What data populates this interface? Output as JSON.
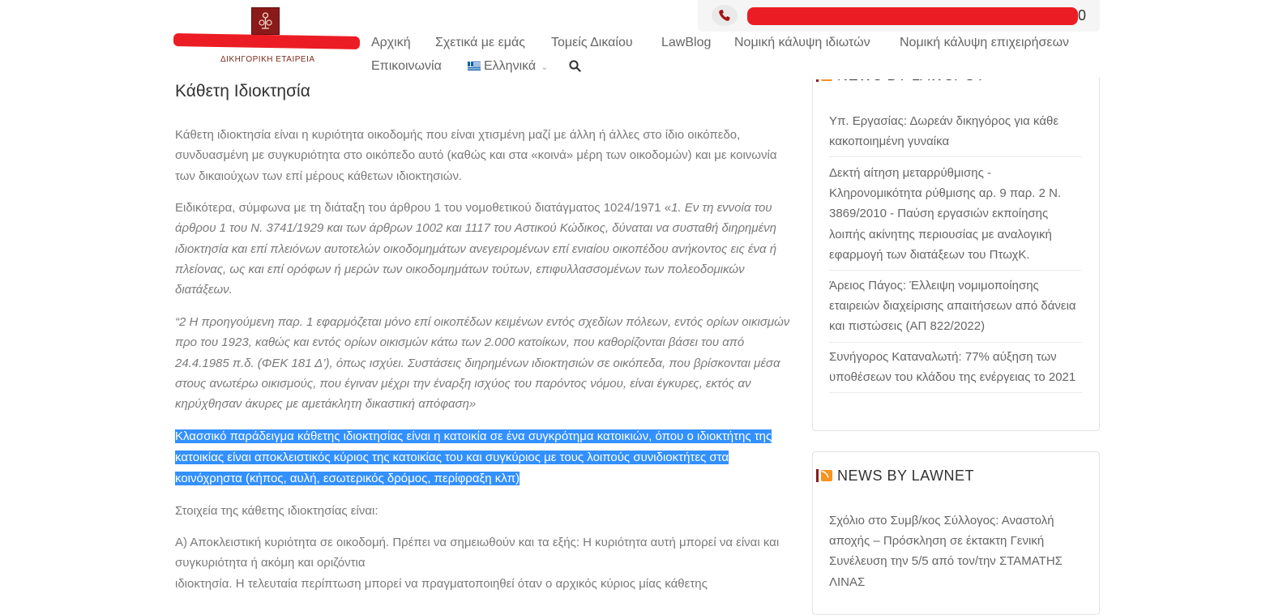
{
  "header": {
    "logo_tagline": "ΔΙΚΗΓΟΡΙΚΗ ΕΤΑΙΡΕΙΑ",
    "phone_tail": "0",
    "nav": [
      "Αρχική",
      "Σχετικά με εμάς",
      "Τομείς Δικαίου",
      "LawBlog",
      "Νομική κάλυψη ιδιωτών",
      "Νομική κάλυψη επιχειρήσεων",
      "Επικοινωνία",
      "Ελληνικά"
    ],
    "search_icon": "search-icon",
    "colors": {
      "redaction": "#ec1c24",
      "logo_bg": "#8b1a1a"
    }
  },
  "article": {
    "title": "Κάθετη Ιδιοκτησία",
    "p1": "Κάθετη ιδιοκτησία είναι η κυριότητα οικοδομής που είναι χτισμένη μαζί με άλλη ή άλλες στο ίδιο οικόπεδο, συνδυασμένη με συγκυριότητα στο οικόπεδο αυτό (καθώς και στα «κοινά» μέρη των οικοδομών) και με κοινωνία των δικαιούχων των επί μέρους κάθετων ιδιοκτησιών.",
    "p2_plain": "Ειδικότερα, σύμφωνα με τη διάταξη του άρθρου 1 του νομοθετικού διατάγματος 1024/1971 «",
    "p2_italic": "1. Εν τη εννοία του άρθρου 1 του Ν. 3741/1929 και των άρθρων 1002 και 1117 του Αστικού Κώδικος, δύναται να συσταθή διηρημένη ιδιοκτησία και επί πλειόνων αυτοτελών οικοδομημάτων ανεγειρομένων επί ενιαίου οικοπέδου ανήκοντος εις ένα ή πλείονας, ως και επί ορόφων ή μερών των οικοδομημάτων τούτων, επιφυλλασσομένων των πολεοδομικών διατάξεων.",
    "p3": "“2 Η προηγούμενη παρ. 1 εφαρμόζεται μόνο επί οικοπέδων κειμένων εντός σχεδίων πόλεων, εντός ορίων οικισμών προ του 1923, καθώς και εντός ορίων οικισμών κάτω των 2.000 κατοίκων, που καθορίζονται βάσει του από 24.4.1985 π.δ. (ΦΕΚ 181 Δ’), όπως ισχύει. Συστάσεις διηρημένων ιδιοκτησιών σε οικόπεδα, που βρίσκονται μέσα στους ανωτέρω οικισμούς, που έγιναν μέχρι την έναρξη ισχύος του παρόντος νόμου, είναι έγκυρες, εκτός αν κηρύχθησαν άκυρες με αμετάκλητη δικαστική απόφαση»",
    "p4_selected": "Κλασσικό παράδειγμα κάθετης ιδιοκτησίας είναι η κατοικία σε ένα συγκρότημα κατοικιών, όπου ο ιδιοκτήτης της κατοικίας είναι αποκλειστικός κύριος της κατοικίας του και συγκύριος με τους λοιπούς συνιδιοκτήτες στα κοινόχρηστα (κήπος, αυλή, εσωτερικός δρόμος, περίφραξη κλπ)",
    "p5": "Στοιχεία της κάθετης ιδιοκτησίας είναι:",
    "p6a": "Α) Αποκλειστική κυριότητα σε οικοδομή. Πρέπει να σημειωθούν και τα εξής: Η κυριότητα αυτή μπορεί να είναι και συγκυριότητα ή ακόμη και οριζόντια",
    "p6b": "ιδιοκτησία. Η τελευταία περίπτωση μπορεί να πραγματοποιηθεί όταν ο αρχικός κύριος μίας κάθετης"
  },
  "sidebar": {
    "lawspot": {
      "title": "NEWS BY LAWSPOT",
      "items": [
        "Υπ. Εργασίας: Δωρεάν δικηγόρος για κάθε κακοποιημένη γυναίκα",
        "Δεκτή αίτηση μεταρρύθμισης - Κληρονομικότητα ρύθμισης αρ. 9 παρ. 2 Ν. 3869/2010 - Παύση εργασιών εκποίησης λοιπής ακίνητης περιουσίας με αναλογική εφαρμογή των διατάξεων του ΠτωχΚ.",
        "Άρειος Πάγος: Έλλειψη νομιμοποίησης εταιρειών διαχείρισης απαιτήσεων από δάνεια και πιστώσεις (ΑΠ 822/2022)",
        "Συνήγορος Καταναλωτή: 77% αύξηση των υποθέσεων του κλάδου της ενέργειας το 2021"
      ]
    },
    "lawnet": {
      "title": "NEWS BY LAWNET",
      "items": [
        "Σχόλιο στο Συμβ/κος Σύλλογος: Αναστολή αποχής – Πρόσκληση σε έκτακτη Γενική Συνέλευση την 5/5 από τον/την ΣΤΑΜΑΤΗΣ ΛΙΝΑΣ"
      ]
    }
  }
}
